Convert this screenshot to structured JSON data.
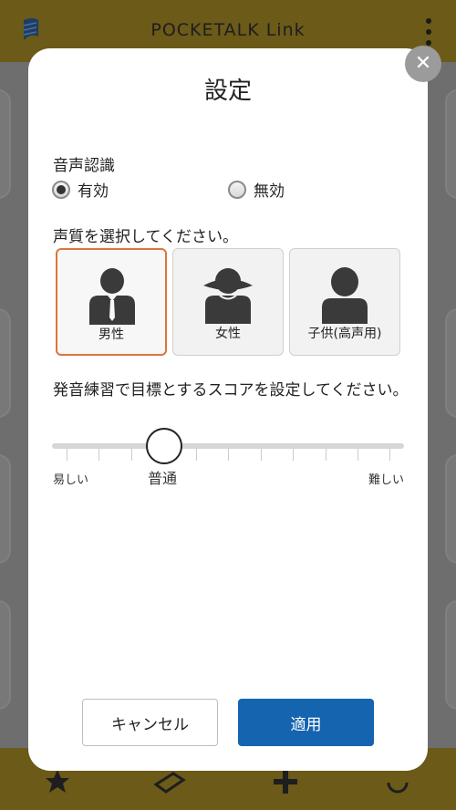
{
  "app": {
    "title": "POCKETALK Link",
    "footer_icons": [
      "star-icon",
      "book-icon",
      "plus-icon",
      "refresh-icon"
    ]
  },
  "dialog": {
    "title": "設定",
    "close_icon": "close-icon",
    "speech_recognition": {
      "label": "音声認識",
      "options": [
        {
          "label": "有効",
          "checked": true
        },
        {
          "label": "無効",
          "checked": false
        }
      ]
    },
    "voice": {
      "label": "声質を選択してください。",
      "options": [
        {
          "label": "男性",
          "icon": "male-person-icon",
          "selected": true
        },
        {
          "label": "女性",
          "icon": "female-person-icon",
          "selected": false
        },
        {
          "label": "子供(高声用)",
          "icon": "child-person-icon",
          "selected": false
        }
      ]
    },
    "score": {
      "label": "発音練習で目標とするスコアを設定してください。",
      "min_label": "易しい",
      "current_label": "普通",
      "max_label": "難しい",
      "level": 0.3
    },
    "buttons": {
      "cancel": "キャンセル",
      "apply": "適用"
    },
    "colors": {
      "accent": "#d9763e",
      "primary": "#1464b0",
      "header": "#6b5a18"
    }
  }
}
